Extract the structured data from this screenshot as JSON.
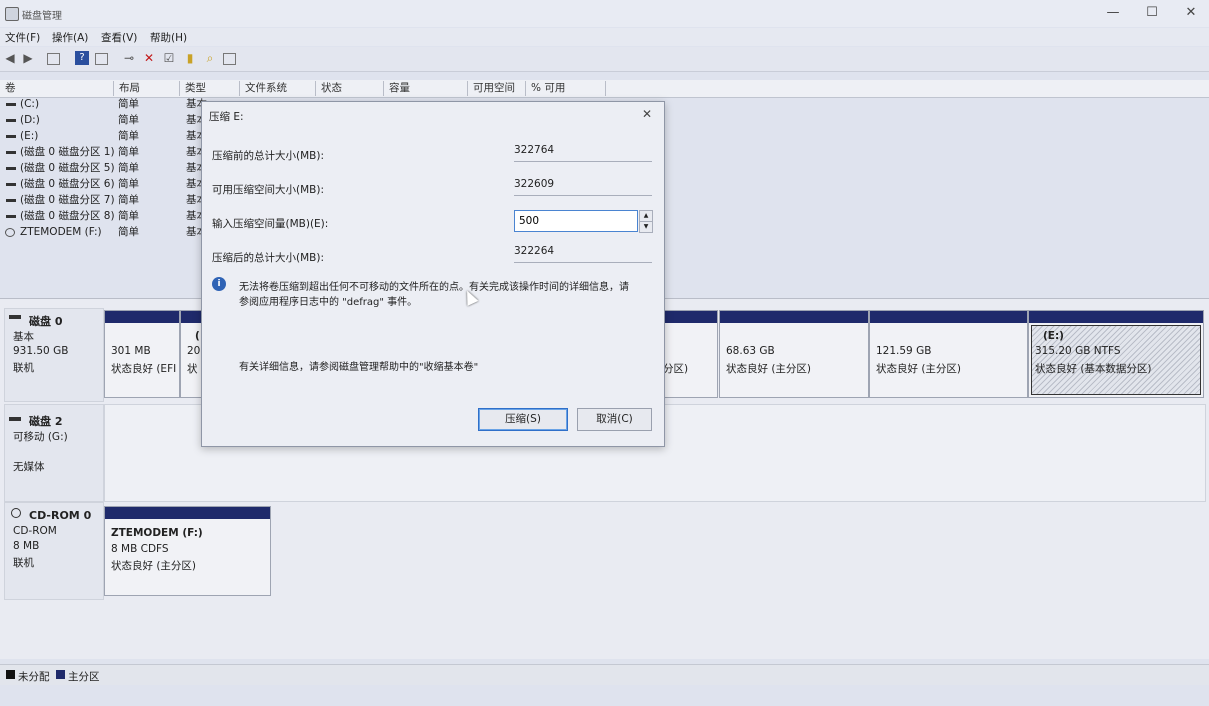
{
  "window": {
    "title": "磁盘管理",
    "minimize": "—",
    "maximize": "☐",
    "close": "✕"
  },
  "menu": [
    "文件(F)",
    "操作(A)",
    "查看(V)",
    "帮助(H)"
  ],
  "toolbar_icons": [
    "back-icon",
    "forward-icon",
    "disk-list-icon",
    "help-icon",
    "properties-icon",
    "connect-icon",
    "delete-icon",
    "check-icon",
    "folder-icon",
    "search-icon",
    "view-icon"
  ],
  "volume_columns": [
    "卷",
    "布局",
    "类型",
    "文件系统",
    "状态",
    "容量",
    "可用空间",
    "% 可用"
  ],
  "volumes": [
    {
      "name": "(C:)",
      "layout": "简单",
      "type": "基本"
    },
    {
      "name": "(D:)",
      "layout": "简单",
      "type": "基本"
    },
    {
      "name": "(E:)",
      "layout": "简单",
      "type": "基本"
    },
    {
      "name": "(磁盘 0 磁盘分区 1)",
      "layout": "简单",
      "type": "基本"
    },
    {
      "name": "(磁盘 0 磁盘分区 5)",
      "layout": "简单",
      "type": "基本"
    },
    {
      "name": "(磁盘 0 磁盘分区 6)",
      "layout": "简单",
      "type": "基本"
    },
    {
      "name": "(磁盘 0 磁盘分区 7)",
      "layout": "简单",
      "type": "基本"
    },
    {
      "name": "(磁盘 0 磁盘分区 8)",
      "layout": "简单",
      "type": "基本"
    },
    {
      "name": "ZTEMODEM (F:)",
      "layout": "简单",
      "type": "基本"
    }
  ],
  "disk0": {
    "title": "磁盘 0",
    "kind": "基本",
    "size": "931.50 GB",
    "status": "联机",
    "p1_size": "301 MB",
    "p1_status": "状态良好 (EFI",
    "p2_label": "(",
    "p2_size": "20",
    "p2_status": "状",
    "p3_status": "分区)",
    "p4_size": "68.63 GB",
    "p4_status": "状态良好 (主分区)",
    "p5_size": "121.59 GB",
    "p5_status": "状态良好 (主分区)",
    "p6_name": "(E:)",
    "p6_size": "315.20 GB NTFS",
    "p6_status": "状态良好 (基本数据分区)"
  },
  "disk2": {
    "title": "磁盘 2",
    "kind": "可移动 (G:)",
    "media": "无媒体"
  },
  "cdrom": {
    "title": "CD-ROM 0",
    "kind": "CD-ROM",
    "size": "8 MB",
    "status": "联机",
    "part_name": "ZTEMODEM  (F:)",
    "part_size": "8 MB CDFS",
    "part_status": "状态良好 (主分区)"
  },
  "legend": [
    "未分配",
    "主分区"
  ],
  "dialog": {
    "title": "压缩 E:",
    "close": "✕",
    "total_before_label": "压缩前的总计大小(MB):",
    "total_before": "322764",
    "available_label": "可用压缩空间大小(MB):",
    "available": "322609",
    "amount_label": "输入压缩空间量(MB)(E):",
    "amount": "500",
    "total_after_label": "压缩后的总计大小(MB):",
    "total_after": "322264",
    "info_line1": "无法将卷压缩到超出任何不可移动的文件所在的点。有关完成该操作时间的详细信息，请",
    "info_line2": "参阅应用程序日志中的 \"defrag\" 事件。",
    "help_text": "有关详细信息，请参阅磁盘管理帮助中的\"收缩基本卷\"",
    "shrink_button": "压缩(S)",
    "cancel_button": "取消(C)"
  }
}
